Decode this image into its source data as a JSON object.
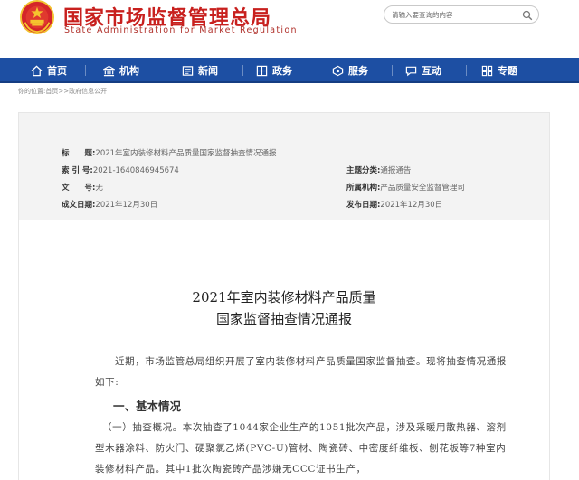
{
  "header": {
    "site_title": "国家市场监督管理总局",
    "site_subtitle": "State Administration for Market Regulation",
    "search_placeholder": "请输入要查询的内容"
  },
  "nav": {
    "items": [
      {
        "label": "首页",
        "icon": "home-icon"
      },
      {
        "label": "机构",
        "icon": "institution-icon"
      },
      {
        "label": "新闻",
        "icon": "news-icon"
      },
      {
        "label": "政务",
        "icon": "government-icon"
      },
      {
        "label": "服务",
        "icon": "service-icon"
      },
      {
        "label": "互动",
        "icon": "interaction-icon"
      },
      {
        "label": "专题",
        "icon": "topic-icon"
      }
    ]
  },
  "breadcrumb": "你的位置:首页>>政府信息公开",
  "meta": {
    "title_label": "标　　题:",
    "title_value": "2021年室内装修材料产品质量国家监督抽查情况通报",
    "index_label": "索  引  号:",
    "index_value": "2021-1640846945674",
    "docno_label": "文　　号:",
    "docno_value": "无",
    "date_label": "成文日期:",
    "date_value": "2021年12月30日",
    "category_label": "主题分类:",
    "category_value": "通报通告",
    "org_label": "所属机构:",
    "org_value": "产品质量安全监督管理司",
    "pub_label": "发布日期:",
    "pub_value": "2021年12月30日"
  },
  "document": {
    "title_line1": "2021年室内装修材料产品质量",
    "title_line2": "国家监督抽查情况通报",
    "intro": "近期，市场监管总局组织开展了室内装修材料产品质量国家监督抽查。现将抽查情况通报如下:",
    "section1_heading": "一、基本情况",
    "section1_para": "（一）抽查概况。本次抽查了1044家企业生产的1051批次产品，涉及采暖用散热器、溶剂型木器涂料、防火门、硬聚氯乙烯(PVC-U)管材、陶瓷砖、中密度纤维板、刨花板等7种室内装修材料产品。其中1批次陶瓷砖产品涉嫌无CCC证书生产，"
  },
  "colors": {
    "brand_red": "#c8201e",
    "nav_blue": "#1d4fa3",
    "meta_bg": "#f3f3f3"
  }
}
